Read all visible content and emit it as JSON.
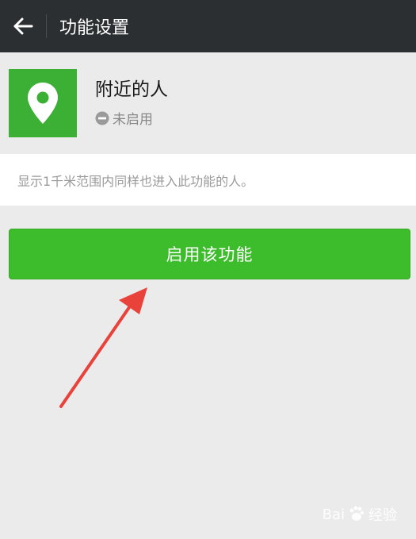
{
  "topbar": {
    "title": "功能设置"
  },
  "feature": {
    "name": "附近的人",
    "status": "未启用"
  },
  "description": {
    "text": "显示1千米范围内同样也进入此功能的人。"
  },
  "actions": {
    "enable_label": "启用该功能"
  },
  "watermark": {
    "left": "Bai",
    "right": "经验"
  },
  "icons": {
    "back": "arrow-left-icon",
    "feature": "location-pin-icon",
    "status": "minus-circle-icon",
    "annotation": "red-arrow-icon"
  },
  "colors": {
    "topbar": "#2b2f31",
    "accent_green": "#3ebd2c",
    "feature_icon_bg": "#3cb034",
    "annotation_red": "#e8423a"
  }
}
